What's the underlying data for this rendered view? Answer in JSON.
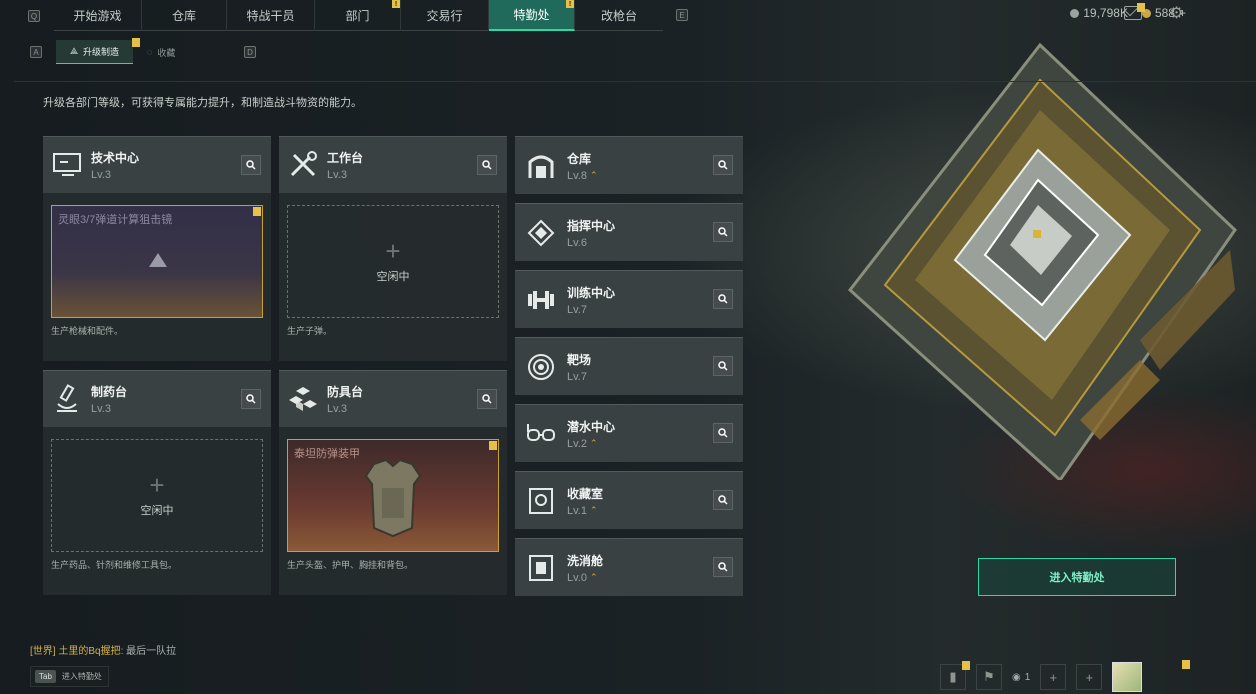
{
  "nav": {
    "left_key": "Q",
    "right_key": "E",
    "tabs": [
      {
        "label": "开始游戏",
        "alert": false
      },
      {
        "label": "仓库",
        "alert": false
      },
      {
        "label": "特战干员",
        "alert": false
      },
      {
        "label": "部门",
        "alert": true
      },
      {
        "label": "交易行",
        "alert": false
      },
      {
        "label": "特勤处",
        "alert": true,
        "active": true
      },
      {
        "label": "改枪台",
        "alert": false
      }
    ]
  },
  "currency": {
    "silver": "19,798K",
    "gold": "588"
  },
  "subnav": {
    "left_key": "A",
    "right_key": "D",
    "tabs": [
      {
        "label": "升级制造",
        "active": true
      },
      {
        "label": "收藏"
      }
    ]
  },
  "intro": "升级各部门等级，可获得专属能力提升，和制造战斗物资的能力。",
  "facilities": [
    {
      "title": "技术中心",
      "level": "Lv.3",
      "slot_item": "灵眼3/7弹道计算狙击镜",
      "desc": "生产枪械和配件。",
      "icon": "monitor-icon"
    },
    {
      "title": "工作台",
      "level": "Lv.3",
      "slot_item": "空闲中",
      "desc": "生产子弹。",
      "icon": "tools-icon"
    },
    {
      "title": "制药台",
      "level": "Lv.3",
      "slot_item": "空闲中",
      "desc": "生产药品、针剂和维修工具包。",
      "icon": "microscope-icon"
    },
    {
      "title": "防具台",
      "level": "Lv.3",
      "slot_item": "泰坦防弹装甲",
      "desc": "生产头盔、护甲、胸挂和背包。",
      "icon": "blocks-icon"
    }
  ],
  "side_facilities": [
    {
      "title": "仓库",
      "level": "Lv.8",
      "upgradable": true,
      "icon": "garage-icon"
    },
    {
      "title": "指挥中心",
      "level": "Lv.6",
      "upgradable": false,
      "icon": "command-icon"
    },
    {
      "title": "训练中心",
      "level": "Lv.7",
      "upgradable": false,
      "icon": "dumbbell-icon"
    },
    {
      "title": "靶场",
      "level": "Lv.7",
      "upgradable": false,
      "icon": "target-icon"
    },
    {
      "title": "潜水中心",
      "level": "Lv.2",
      "upgradable": true,
      "icon": "goggles-icon"
    },
    {
      "title": "收藏室",
      "level": "Lv.1",
      "upgradable": true,
      "icon": "vault-icon"
    },
    {
      "title": "洗消舱",
      "level": "Lv.0",
      "upgradable": true,
      "icon": "shower-icon"
    }
  ],
  "enter_button": "进入特勤处",
  "chat": {
    "channel": "[世界]",
    "name": "土里的Bq握把:",
    "message": "最后一队拉"
  },
  "tab_hint": {
    "key": "Tab",
    "label": "进入特勤处"
  },
  "party_count": "1"
}
